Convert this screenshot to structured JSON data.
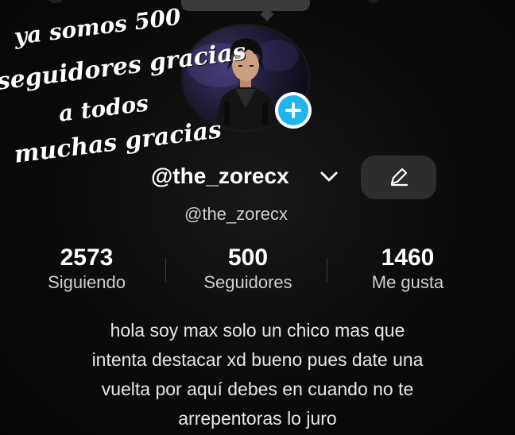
{
  "overlay_caption": {
    "line1": "ya somos 500",
    "line2": "seguidores gracias",
    "line3": "a todos",
    "line4": "muchas gracias"
  },
  "profile": {
    "display_name": "@the_zorecx",
    "username": "@the_zorecx"
  },
  "stats": {
    "following": {
      "value": "2573",
      "label": "Siguiendo"
    },
    "followers": {
      "value": "500",
      "label": "Seguidores"
    },
    "likes": {
      "value": "1460",
      "label": "Me gusta"
    }
  },
  "bio": {
    "line1": "hola soy max solo un chico mas que",
    "line2": "intenta destacar xd bueno pues date una",
    "line3": "vuelta por aquí debes en cuando no te",
    "line4": "arrepentoras lo juro"
  },
  "icons": {
    "add_badge": "plus-icon",
    "username_menu": "chevron-down-icon",
    "edit": "pencil-icon"
  },
  "colors": {
    "background": "#000000",
    "accent": "#20b6e8",
    "button": "#2d2d2d"
  }
}
